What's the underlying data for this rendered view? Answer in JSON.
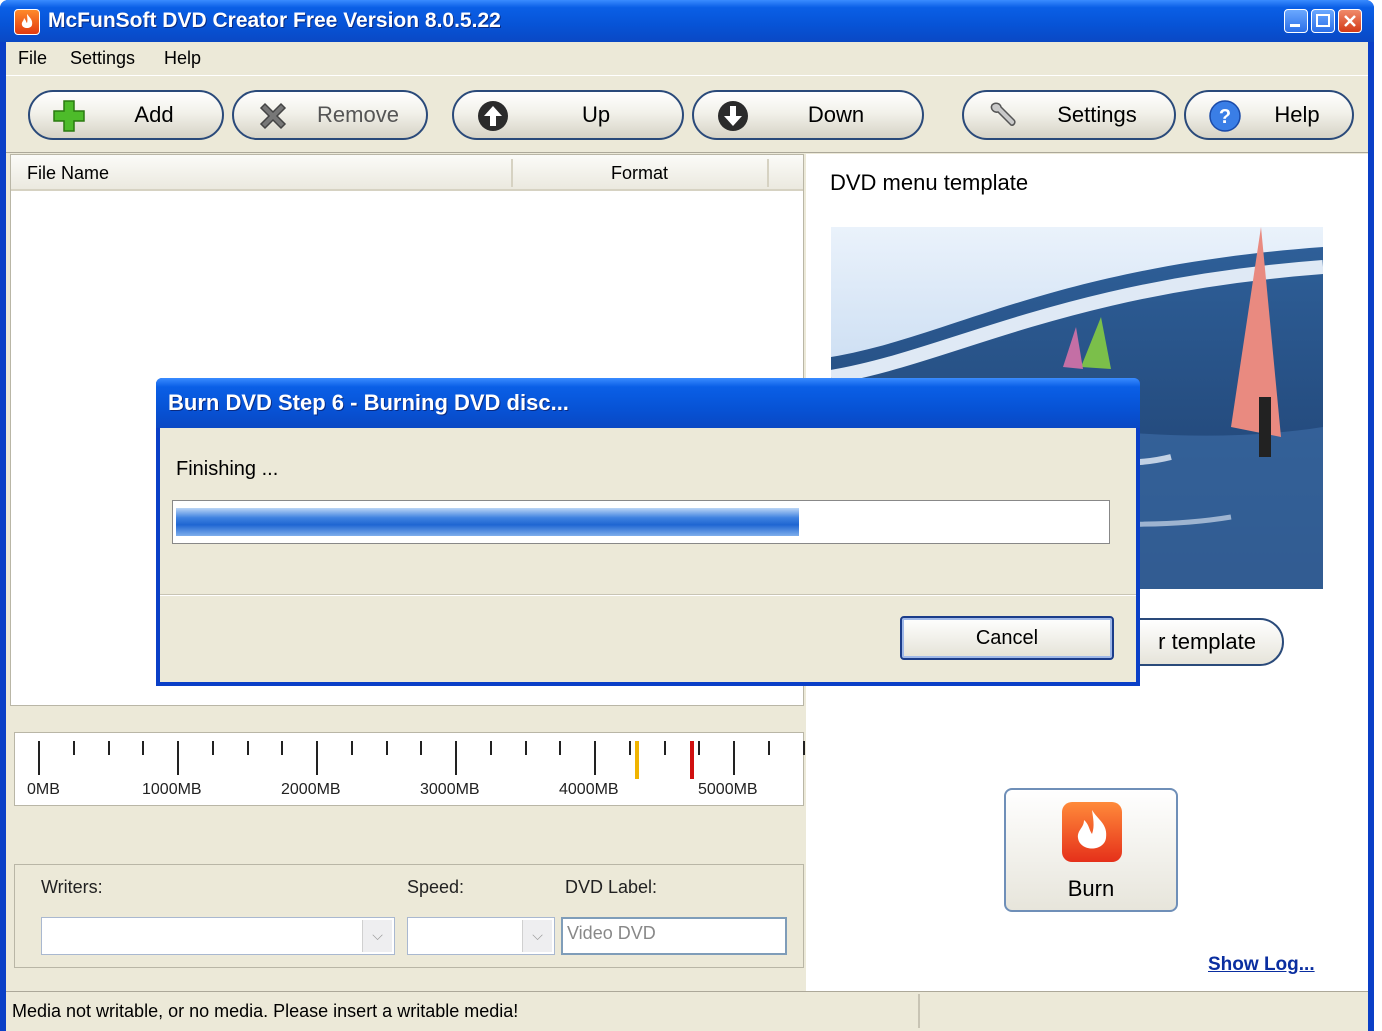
{
  "window": {
    "title": "McFunSoft DVD Creator Free Version 8.0.5.22"
  },
  "menu": {
    "file": "File",
    "settings": "Settings",
    "help": "Help"
  },
  "toolbar": {
    "add": "Add",
    "remove": "Remove",
    "up": "Up",
    "down": "Down",
    "settings": "Settings",
    "help": "Help"
  },
  "file_list": {
    "col_name": "File Name",
    "col_format": "Format"
  },
  "template": {
    "title": "DVD menu template",
    "button_visible_text": "r template"
  },
  "ruler": {
    "labels": [
      "0MB",
      "1000MB",
      "2000MB",
      "3000MB",
      "4000MB",
      "5000MB"
    ],
    "capacity_markers_mb": [
      4300,
      4700
    ]
  },
  "writer": {
    "writers_label": "Writers:",
    "speed_label": "Speed:",
    "dvd_label_label": "DVD Label:",
    "dvd_label_value": "Video DVD"
  },
  "burn": {
    "label": "Burn"
  },
  "show_log": "Show Log...",
  "status": {
    "message": "Media not writable, or no media. Please insert a writable media!"
  },
  "dialog": {
    "title": "Burn DVD Step 6 - Burning DVD disc...",
    "status": "Finishing ...",
    "progress_percent": 67,
    "cancel": "Cancel"
  },
  "colors": {
    "titlebar": "#0a5fe6",
    "window_bg": "#ece9d8",
    "progress": "#2f74da",
    "marker_yellow": "#f0b400",
    "marker_red": "#d01010",
    "link": "#0a2ea0"
  },
  "icons": {
    "add": "plus-icon",
    "remove": "x-icon",
    "up": "arrow-up-icon",
    "down": "arrow-down-icon",
    "settings": "wrench-icon",
    "help": "question-icon",
    "burn": "flame-icon"
  }
}
